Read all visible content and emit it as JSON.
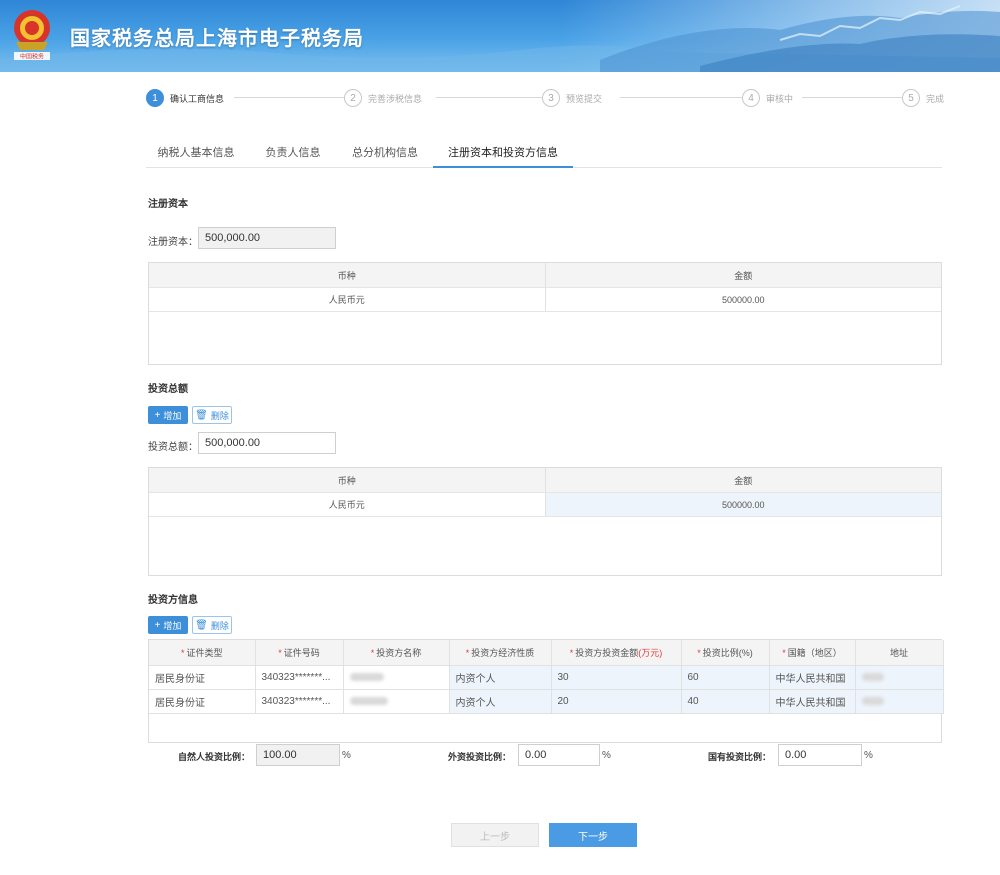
{
  "header": {
    "title": "国家税务总局上海市电子税务局",
    "emblem_text": "中国税务"
  },
  "stepper": [
    {
      "num": "1",
      "label": "确认工商信息",
      "active": true
    },
    {
      "num": "2",
      "label": "完善涉税信息",
      "active": false
    },
    {
      "num": "3",
      "label": "预览提交",
      "active": false
    },
    {
      "num": "4",
      "label": "审核中",
      "active": false
    },
    {
      "num": "5",
      "label": "完成",
      "active": false
    }
  ],
  "tabs": [
    {
      "label": "纳税人基本信息"
    },
    {
      "label": "负责人信息"
    },
    {
      "label": "总分机构信息"
    },
    {
      "label": "注册资本和投资方信息",
      "active": true
    }
  ],
  "registered_capital": {
    "section_title": "注册资本",
    "field_label": "注册资本：",
    "field_value": "500,000.00",
    "table_headers": [
      "币种",
      "金额"
    ],
    "rows": [
      [
        "人民币元",
        "500000.00"
      ]
    ]
  },
  "investment_total": {
    "section_title": "投资总额",
    "add_label": "增加",
    "delete_label": "删除",
    "field_label": "投资总额：",
    "field_value": "500,000.00",
    "table_headers": [
      "币种",
      "金额"
    ],
    "rows": [
      [
        "人民币元",
        "500000.00"
      ]
    ]
  },
  "investors": {
    "section_title": "投资方信息",
    "add_label": "增加",
    "delete_label": "删除",
    "headers": {
      "id_type": "证件类型",
      "id_number": "证件号码",
      "name": "投资方名称",
      "nature": "投资方经济性质",
      "amount_prefix": "投资方投资金额",
      "amount_unit": "(万元)",
      "ratio": "投资比例(%)",
      "country": "国籍（地区）",
      "address": "地址"
    },
    "rows": [
      {
        "id_type": "居民身份证",
        "id_number": "340323*******...",
        "nature": "内资个人",
        "amount": "30",
        "ratio": "60",
        "country": "中华人民共和国"
      },
      {
        "id_type": "居民身份证",
        "id_number": "340323*******...",
        "nature": "内资个人",
        "amount": "20",
        "ratio": "40",
        "country": "中华人民共和国"
      }
    ]
  },
  "ratios": {
    "natural_label": "自然人投资比例：",
    "natural_value": "100.00",
    "foreign_label": "外资投资比例：",
    "foreign_value": "0.00",
    "state_label": "国有投资比例：",
    "state_value": "0.00",
    "pct": "%"
  },
  "footer": {
    "prev_label": "上一步",
    "next_label": "下一步"
  },
  "colors": {
    "accent": "#3d8fd9",
    "header_blue": "#2f86d6",
    "required_red": "#e03b3b"
  }
}
